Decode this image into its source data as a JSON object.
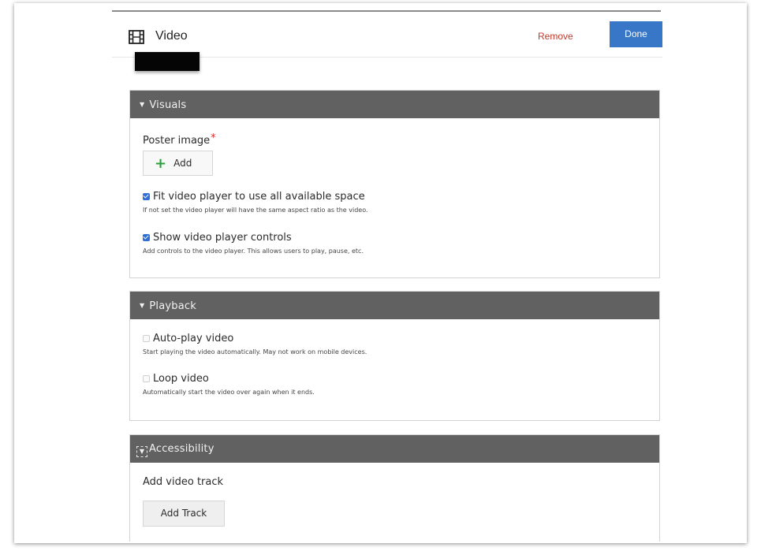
{
  "header": {
    "title": "Video",
    "remove_label": "Remove",
    "done_label": "Done",
    "icon": "film-icon"
  },
  "visuals": {
    "title": "Visuals",
    "poster_label": "Poster image",
    "required_mark": "*",
    "add_label": "Add",
    "fit": {
      "label": "Fit video player to use all available space",
      "help": "If not set the video player will have the same aspect ratio as the video.",
      "checked": true
    },
    "controls": {
      "label": "Show video player controls",
      "help": "Add controls to the video player. This allows users to play, pause, etc.",
      "checked": true
    }
  },
  "playback": {
    "title": "Playback",
    "autoplay": {
      "label": "Auto-play video",
      "help": "Start playing the video automatically. May not work on mobile devices.",
      "checked": false
    },
    "loop": {
      "label": "Loop video",
      "help": "Automatically start the video over again when it ends.",
      "checked": false
    }
  },
  "accessibility": {
    "title": "Accessibility",
    "track_label": "Add video track",
    "add_track_label": "Add Track"
  },
  "colors": {
    "done_button": "#3876c7",
    "remove_text": "#c0392b",
    "panel_header": "#616161",
    "checkbox_checked": "#2f6fd6",
    "add_plus": "#2e9d3a"
  }
}
